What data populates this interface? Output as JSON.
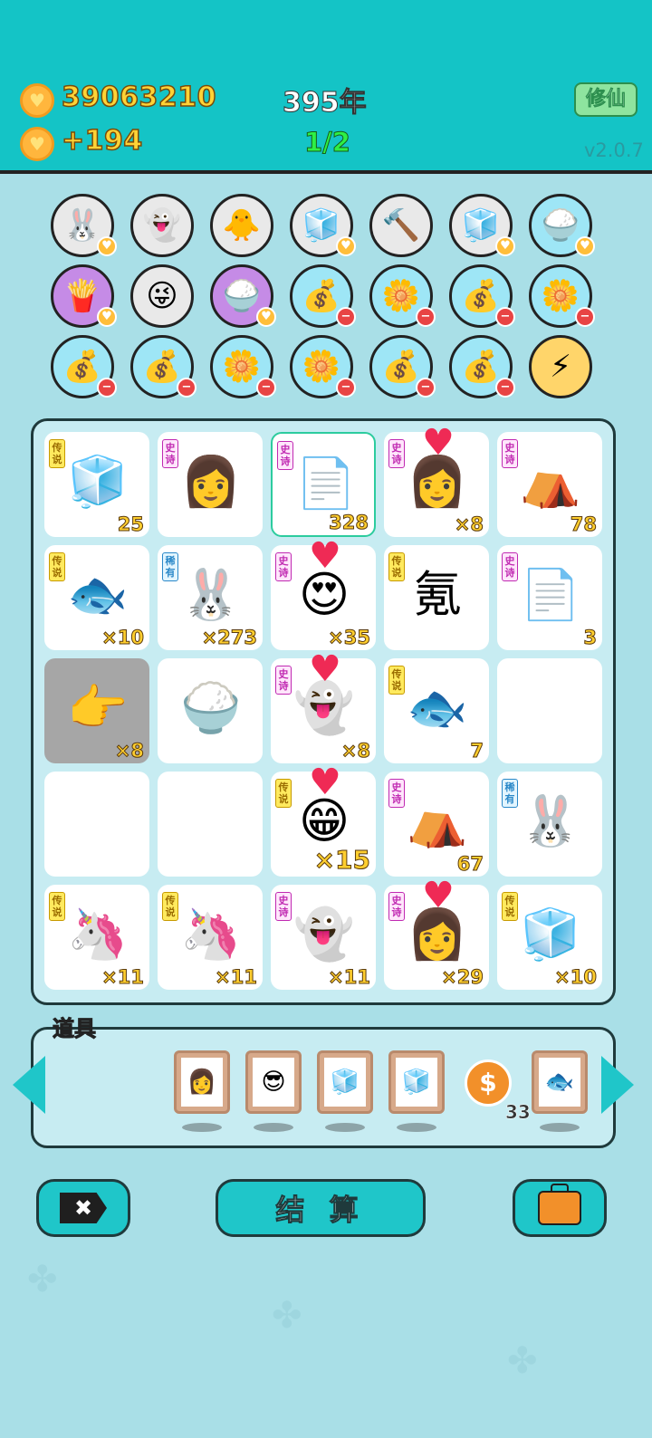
{
  "header": {
    "coins": "39063210",
    "income": "+194",
    "year": "395年",
    "progress": "1/2",
    "cultivate_button": "修仙",
    "version": "v2.0.7"
  },
  "badges": [
    {
      "icon": "🐰",
      "color": "gray",
      "mark": "plus"
    },
    {
      "icon": "👻",
      "color": "gray",
      "mark": ""
    },
    {
      "icon": "🐥",
      "color": "gray",
      "mark": ""
    },
    {
      "icon": "🧊",
      "color": "gray",
      "mark": "plus"
    },
    {
      "icon": "🔨",
      "color": "gray",
      "mark": ""
    },
    {
      "icon": "🧊",
      "color": "gray",
      "mark": "plus"
    },
    {
      "icon": "🍚",
      "color": "blue",
      "mark": "plus"
    },
    {
      "icon": "🍟",
      "color": "purple",
      "mark": "plus"
    },
    {
      "icon": "😜",
      "color": "gray",
      "mark": ""
    },
    {
      "icon": "🍚",
      "color": "purple",
      "mark": "plus"
    },
    {
      "icon": "💰",
      "color": "blue",
      "mark": "minus"
    },
    {
      "icon": "🌼",
      "color": "blue",
      "mark": "minus"
    },
    {
      "icon": "💰",
      "color": "blue",
      "mark": "minus"
    },
    {
      "icon": "🌼",
      "color": "blue",
      "mark": "minus"
    },
    {
      "icon": "💰",
      "color": "blue",
      "mark": "minus"
    },
    {
      "icon": "💰",
      "color": "blue",
      "mark": "minus"
    },
    {
      "icon": "🌼",
      "color": "blue",
      "mark": "minus"
    },
    {
      "icon": "🌼",
      "color": "blue",
      "mark": "minus"
    },
    {
      "icon": "💰",
      "color": "blue",
      "mark": "minus"
    },
    {
      "icon": "💰",
      "color": "blue",
      "mark": "minus"
    },
    {
      "icon": "⚡",
      "color": "gold",
      "mark": ""
    }
  ],
  "board": [
    {
      "tag": "传说",
      "tagType": "legend",
      "icon": "🧊",
      "count": "25"
    },
    {
      "tag": "史诗",
      "tagType": "epic",
      "icon": "👩",
      "count": ""
    },
    {
      "tag": "史诗",
      "tagType": "epic",
      "icon": "📄",
      "count": "328",
      "selected": true
    },
    {
      "tag": "史诗",
      "tagType": "epic",
      "icon": "👩",
      "count": "×8",
      "heart": true
    },
    {
      "tag": "史诗",
      "tagType": "epic",
      "icon": "⛺",
      "count": "78"
    },
    {
      "tag": "传说",
      "tagType": "legend",
      "icon": "🐟",
      "count": "×10"
    },
    {
      "tag": "稀有",
      "tagType": "rare",
      "icon": "🐰",
      "count": "×273"
    },
    {
      "tag": "史诗",
      "tagType": "epic",
      "icon": "😍",
      "count": "×35",
      "heart": true
    },
    {
      "tag": "传说",
      "tagType": "legend",
      "icon": "氪",
      "count": ""
    },
    {
      "tag": "史诗",
      "tagType": "epic",
      "icon": "📄",
      "count": "3"
    },
    {
      "tag": "",
      "tagType": "",
      "icon": "👉",
      "count": "×8",
      "gray": true
    },
    {
      "tag": "",
      "tagType": "",
      "icon": "🍚",
      "count": ""
    },
    {
      "tag": "史诗",
      "tagType": "epic",
      "icon": "👻",
      "count": "×8",
      "heart": true
    },
    {
      "tag": "传说",
      "tagType": "legend",
      "icon": "🐟",
      "count": "7"
    },
    {
      "tag": "",
      "tagType": "",
      "icon": "",
      "count": ""
    },
    {
      "tag": "",
      "tagType": "",
      "icon": "",
      "count": ""
    },
    {
      "tag": "",
      "tagType": "",
      "icon": "",
      "count": ""
    },
    {
      "tag": "传说",
      "tagType": "legend",
      "icon": "😁",
      "count": "×15",
      "heart": true,
      "big": true
    },
    {
      "tag": "史诗",
      "tagType": "epic",
      "icon": "⛺",
      "count": "67"
    },
    {
      "tag": "稀有",
      "tagType": "rare",
      "icon": "🐰",
      "count": ""
    },
    {
      "tag": "传说",
      "tagType": "legend",
      "icon": "🦄",
      "count": "×11"
    },
    {
      "tag": "传说",
      "tagType": "legend",
      "icon": "🦄",
      "count": "×11"
    },
    {
      "tag": "史诗",
      "tagType": "epic",
      "icon": "👻",
      "count": "×11"
    },
    {
      "tag": "史诗",
      "tagType": "epic",
      "icon": "👩",
      "count": "×29",
      "heart": true
    },
    {
      "tag": "传说",
      "tagType": "legend",
      "icon": "🧊",
      "count": "×10"
    }
  ],
  "props": {
    "label": "道具",
    "frames": [
      "👩",
      "😎",
      "🧊",
      "🧊",
      "🐟"
    ],
    "coin_symbol": "$",
    "coin_count": "33"
  },
  "buttons": {
    "settle": "结 算",
    "cancel_symbol": "✖"
  }
}
